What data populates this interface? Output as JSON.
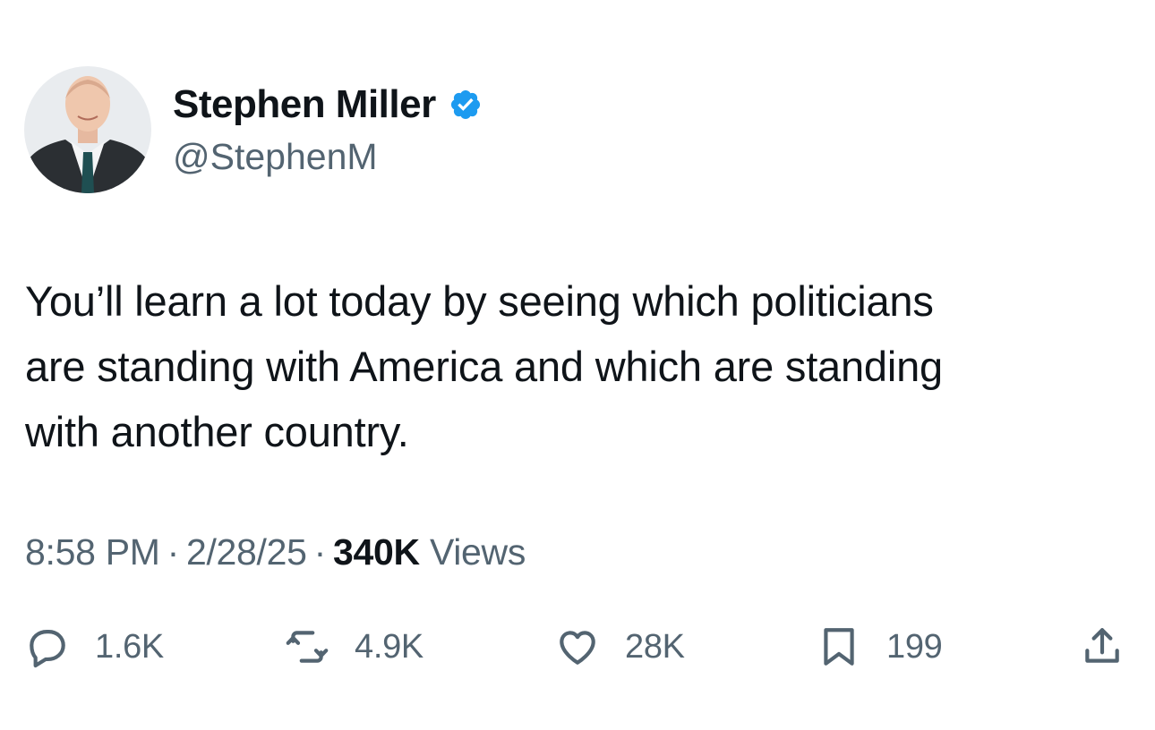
{
  "author": {
    "display_name": "Stephen Miller",
    "handle": "@StephenM",
    "verified": true
  },
  "tweet": {
    "text_lines": [
      "You’ll learn a lot today by seeing which politicians",
      "are standing with America and which are standing",
      "with another country."
    ],
    "time": "8:58 PM",
    "date": "2/28/25",
    "separator": "·",
    "views_count": "340K",
    "views_label": "Views"
  },
  "actions": {
    "replies": "1.6K",
    "reposts": "4.9K",
    "likes": "28K",
    "bookmarks": "199"
  },
  "colors": {
    "text": "#0f1419",
    "secondary": "#536471",
    "verified_blue": "#1d9bf0"
  },
  "icons": [
    "verified-badge-icon",
    "reply-icon",
    "repost-icon",
    "like-icon",
    "bookmark-icon",
    "share-icon"
  ]
}
